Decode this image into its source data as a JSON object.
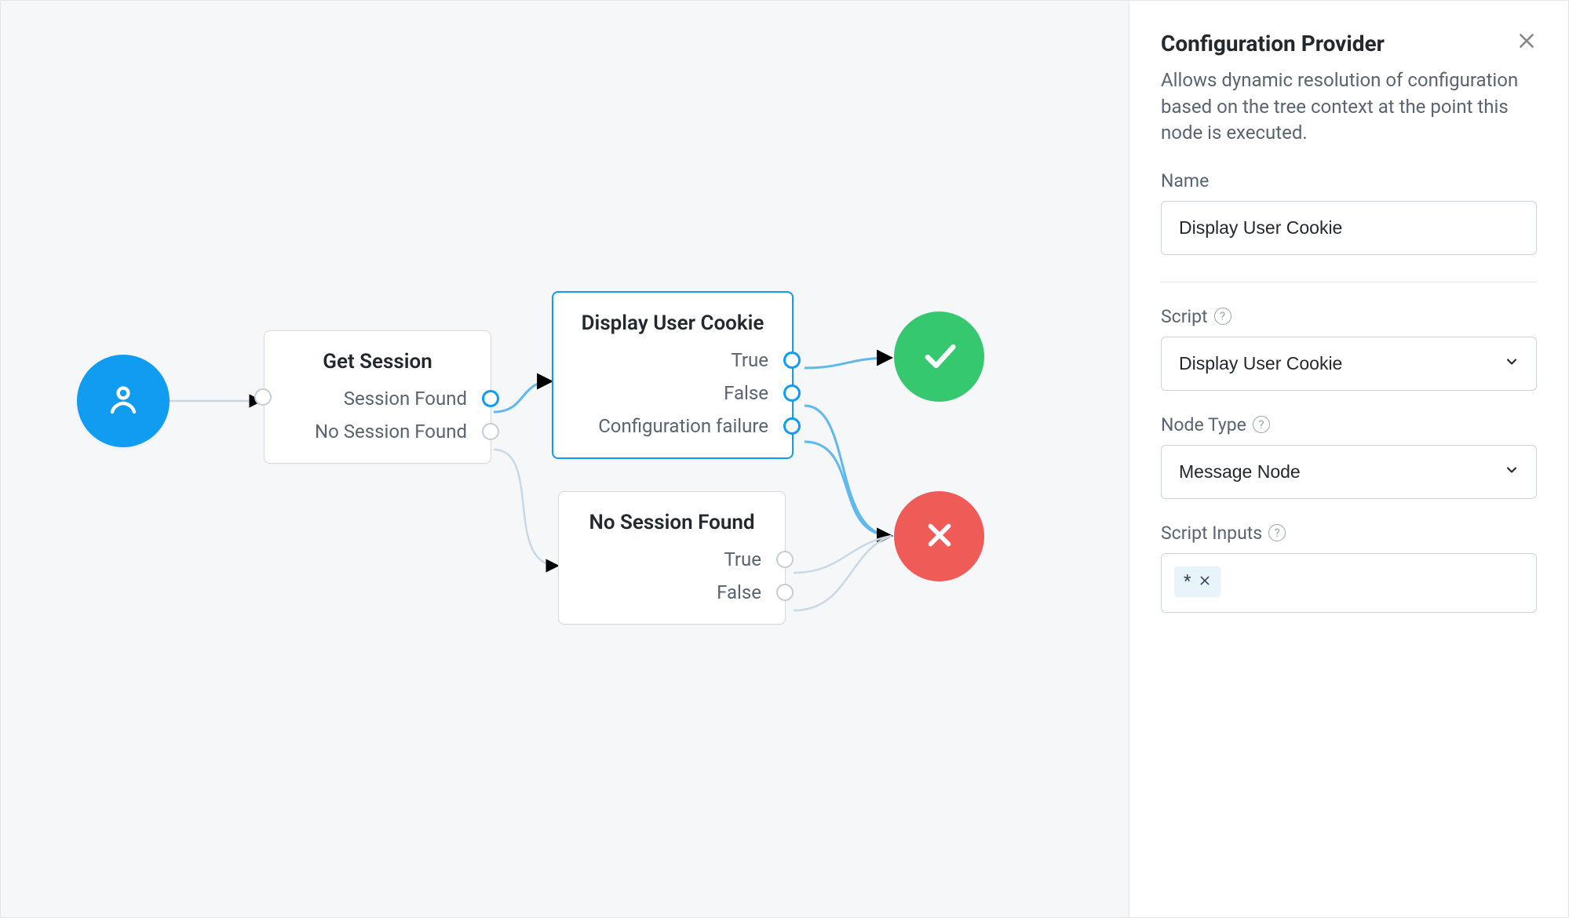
{
  "canvas": {
    "start_node": {
      "icon": "person-icon"
    },
    "nodes": [
      {
        "id": "get-session",
        "title": "Get Session",
        "outputs": [
          "Session Found",
          "No Session Found"
        ]
      },
      {
        "id": "display-user-cookie",
        "title": "Display User Cookie",
        "selected": true,
        "outputs": [
          "True",
          "False",
          "Configuration failure"
        ]
      },
      {
        "id": "no-session-found",
        "title": "No Session Found",
        "outputs": [
          "True",
          "False"
        ]
      }
    ],
    "results": {
      "success": {
        "icon": "check-icon",
        "color": "#36c86e"
      },
      "failure": {
        "icon": "x-icon",
        "color": "#ef5b57"
      }
    }
  },
  "panel": {
    "title": "Configuration Provider",
    "description": "Allows dynamic resolution of configuration based on the tree context at the point this node is executed.",
    "name_label": "Name",
    "name_value": "Display User Cookie",
    "script_label": "Script",
    "script_value": "Display User Cookie",
    "node_type_label": "Node Type",
    "node_type_value": "Message Node",
    "script_inputs_label": "Script Inputs",
    "script_inputs_chips": [
      "*"
    ]
  }
}
